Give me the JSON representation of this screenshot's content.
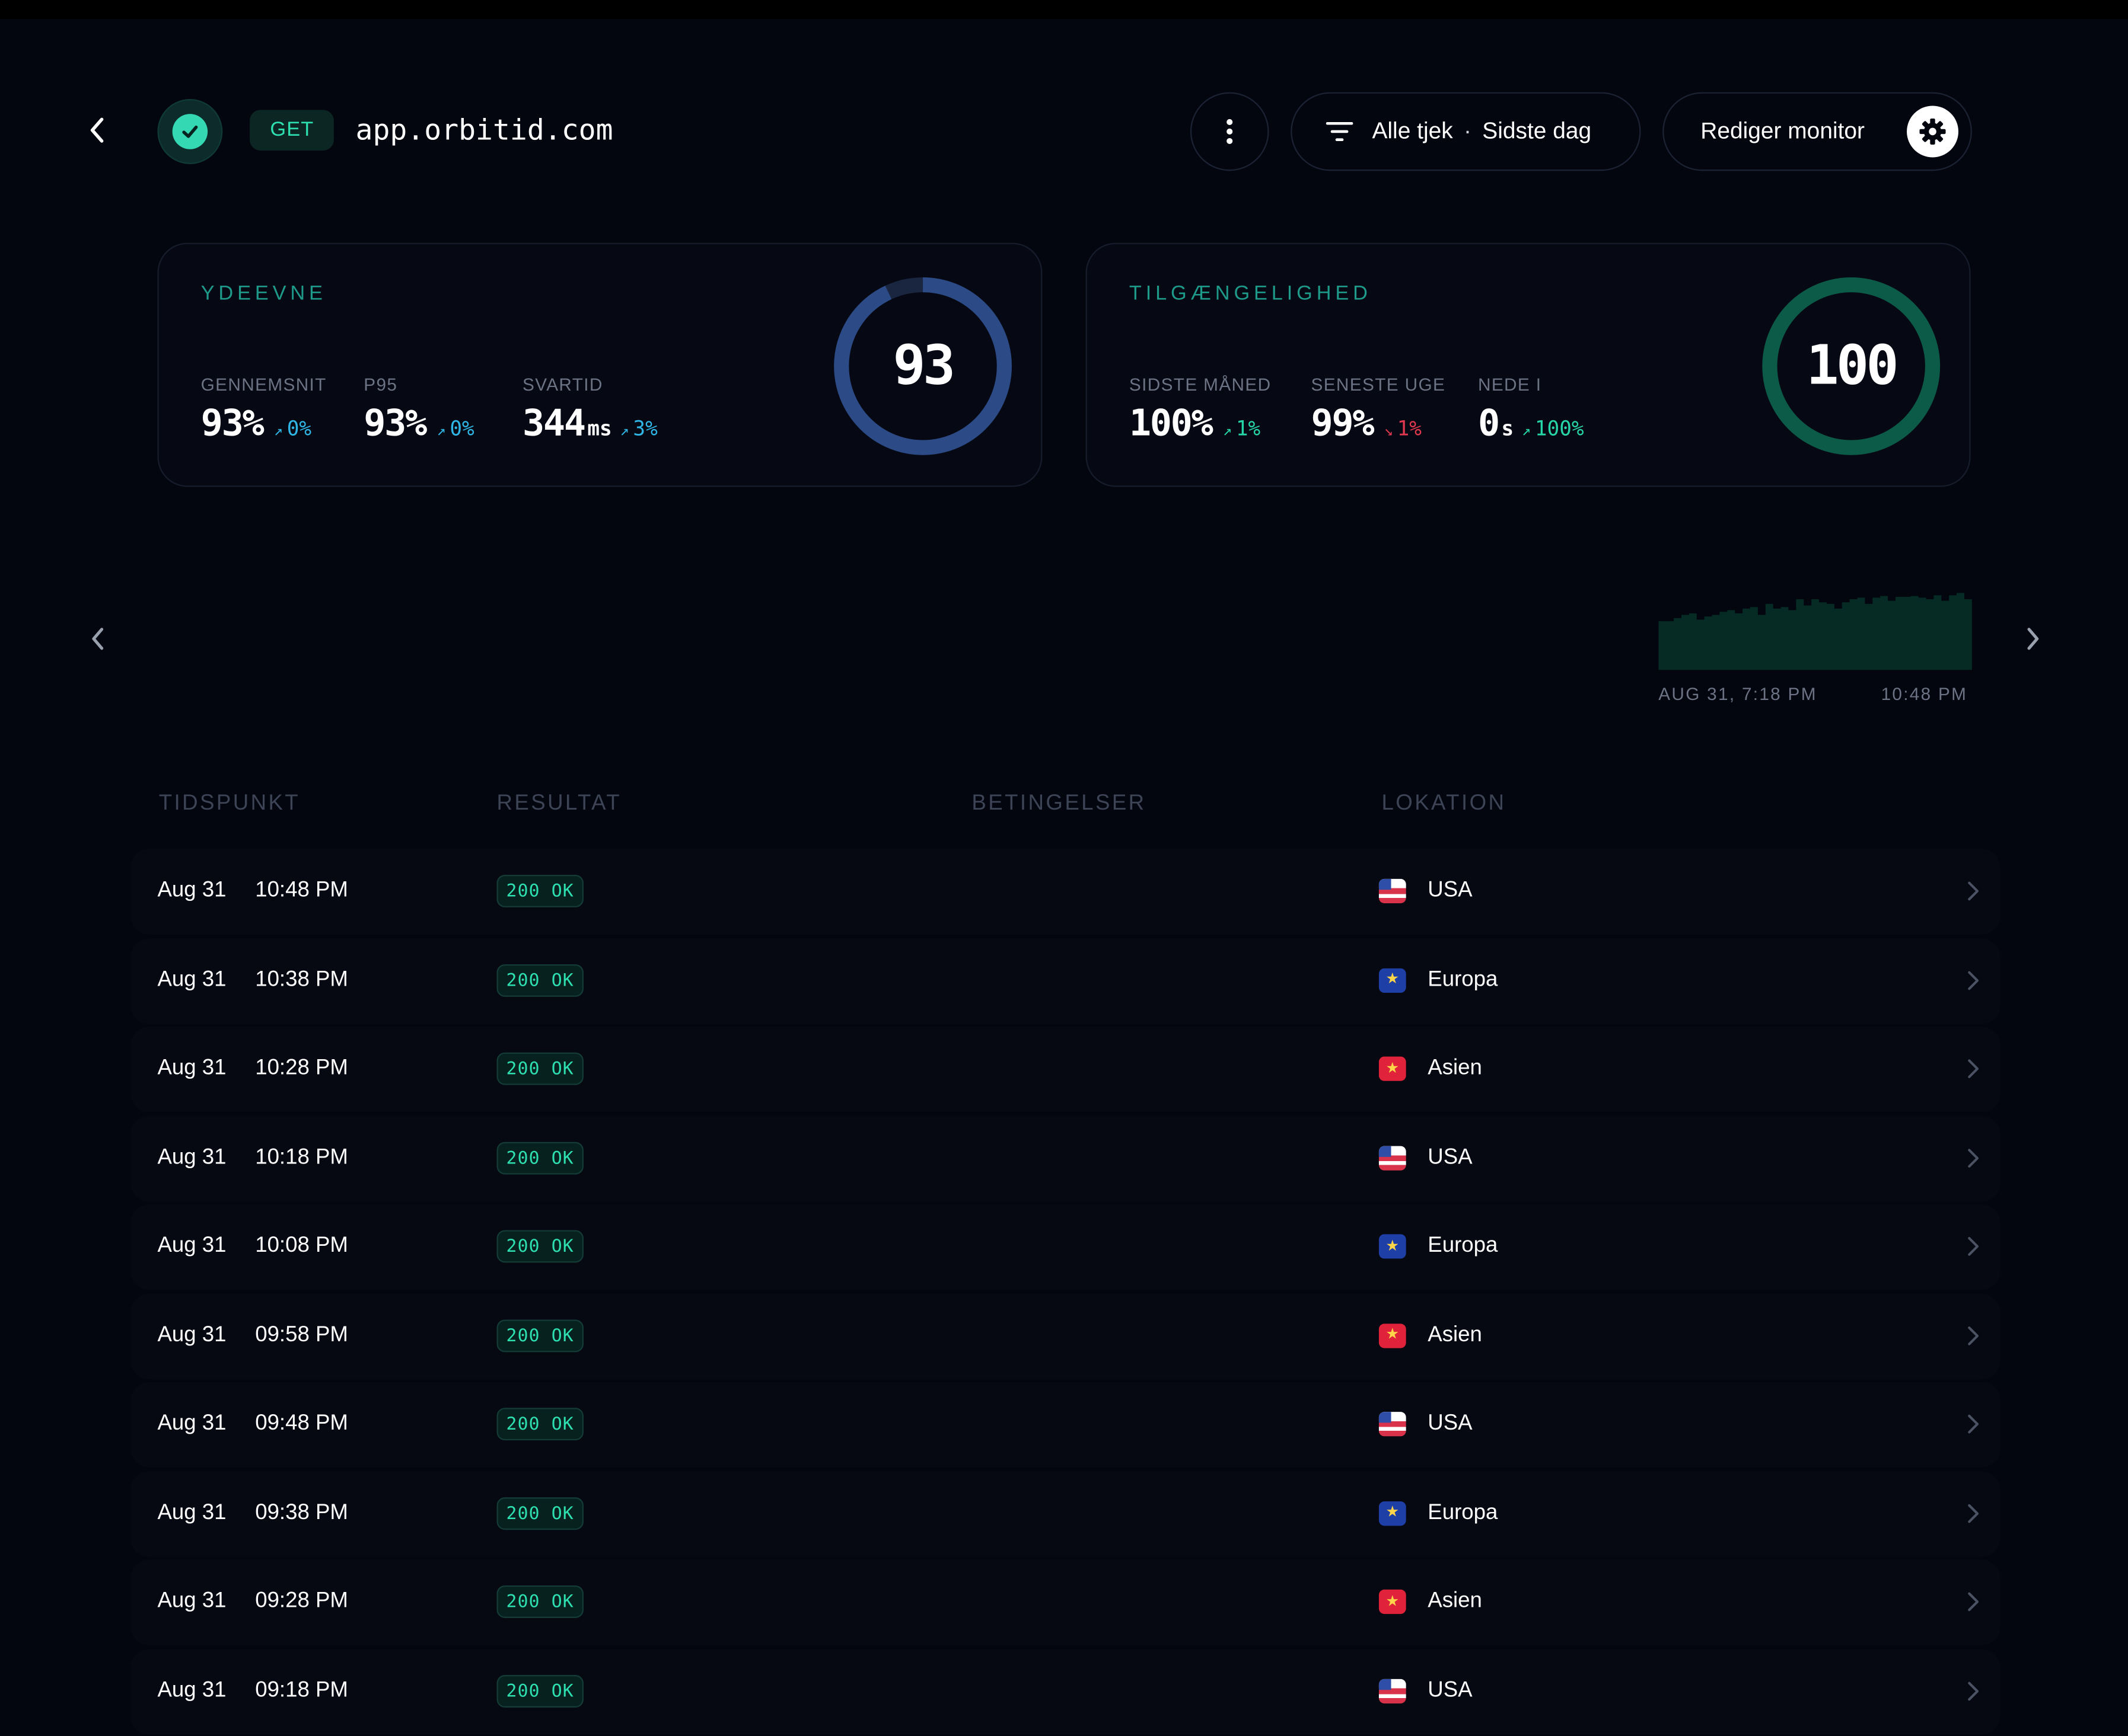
{
  "header": {
    "method": "GET",
    "url": "app.orbitid.com",
    "filter_label": "Alle tjek",
    "filter_separator": "·",
    "filter_range": "Sidste dag",
    "edit_label": "Rediger monitor"
  },
  "performance": {
    "title": "YDEEVNE",
    "score": "93",
    "score_value": 93,
    "metrics": [
      {
        "label": "GENNEMSNIT",
        "value": "93%",
        "unit": "",
        "delta": "0%",
        "trend": "up"
      },
      {
        "label": "P95",
        "value": "93%",
        "unit": "",
        "delta": "0%",
        "trend": "up"
      },
      {
        "label": "SVARTID",
        "value": "344",
        "unit": "ms",
        "delta": "3%",
        "trend": "up"
      }
    ]
  },
  "availability": {
    "title": "TILGÆNGELIGHED",
    "score": "100",
    "score_value": 100,
    "metrics": [
      {
        "label": "SIDSTE MÅNED",
        "value": "100%",
        "unit": "",
        "delta": "1%",
        "trend": "up"
      },
      {
        "label": "SENESTE UGE",
        "value": "99%",
        "unit": "",
        "delta": "1%",
        "trend": "down"
      },
      {
        "label": "NEDE I",
        "value": "0",
        "unit": "s",
        "delta": "100%",
        "trend": "up"
      }
    ]
  },
  "timeline": {
    "start_label": "AUG 31, 7:18 PM",
    "end_label": "10:48 PM",
    "levels": [
      0.62,
      0.62,
      0.66,
      0.7,
      0.72,
      0.64,
      0.68,
      0.7,
      0.74,
      0.76,
      0.72,
      0.78,
      0.8,
      0.7,
      0.84,
      0.78,
      0.8,
      0.76,
      0.9,
      0.82,
      0.9,
      0.86,
      0.84,
      0.78,
      0.86,
      0.9,
      0.92,
      0.84,
      0.92,
      0.94,
      0.88,
      0.93,
      0.93,
      0.94,
      0.92,
      0.9,
      0.95,
      0.88,
      0.95,
      0.98,
      0.9
    ],
    "fill_color": "#062b24"
  },
  "table": {
    "columns": [
      "TIDSPUNKT",
      "RESULTAT",
      "BETINGELSER",
      "LOKATION"
    ],
    "rows": [
      {
        "date": "Aug 31",
        "time": "10:48 PM",
        "status": "200 OK",
        "flag": "us",
        "location": "USA"
      },
      {
        "date": "Aug 31",
        "time": "10:38 PM",
        "status": "200 OK",
        "flag": "eu",
        "location": "Europa"
      },
      {
        "date": "Aug 31",
        "time": "10:28 PM",
        "status": "200 OK",
        "flag": "asia",
        "location": "Asien"
      },
      {
        "date": "Aug 31",
        "time": "10:18 PM",
        "status": "200 OK",
        "flag": "us",
        "location": "USA"
      },
      {
        "date": "Aug 31",
        "time": "10:08 PM",
        "status": "200 OK",
        "flag": "eu",
        "location": "Europa"
      },
      {
        "date": "Aug 31",
        "time": "09:58 PM",
        "status": "200 OK",
        "flag": "asia",
        "location": "Asien"
      },
      {
        "date": "Aug 31",
        "time": "09:48 PM",
        "status": "200 OK",
        "flag": "us",
        "location": "USA"
      },
      {
        "date": "Aug 31",
        "time": "09:38 PM",
        "status": "200 OK",
        "flag": "eu",
        "location": "Europa"
      },
      {
        "date": "Aug 31",
        "time": "09:28 PM",
        "status": "200 OK",
        "flag": "asia",
        "location": "Asien"
      },
      {
        "date": "Aug 31",
        "time": "09:18 PM",
        "status": "200 OK",
        "flag": "us",
        "location": "USA"
      }
    ]
  },
  "colors": {
    "background": "#04060f",
    "accent": "#2ee0b0",
    "performance_ring": "#2b4a86",
    "availability_ring": "#0c5a48",
    "delta_up_blue": "#2fb6e6",
    "delta_up_green": "#26d6a8",
    "delta_down": "#e0384f"
  }
}
